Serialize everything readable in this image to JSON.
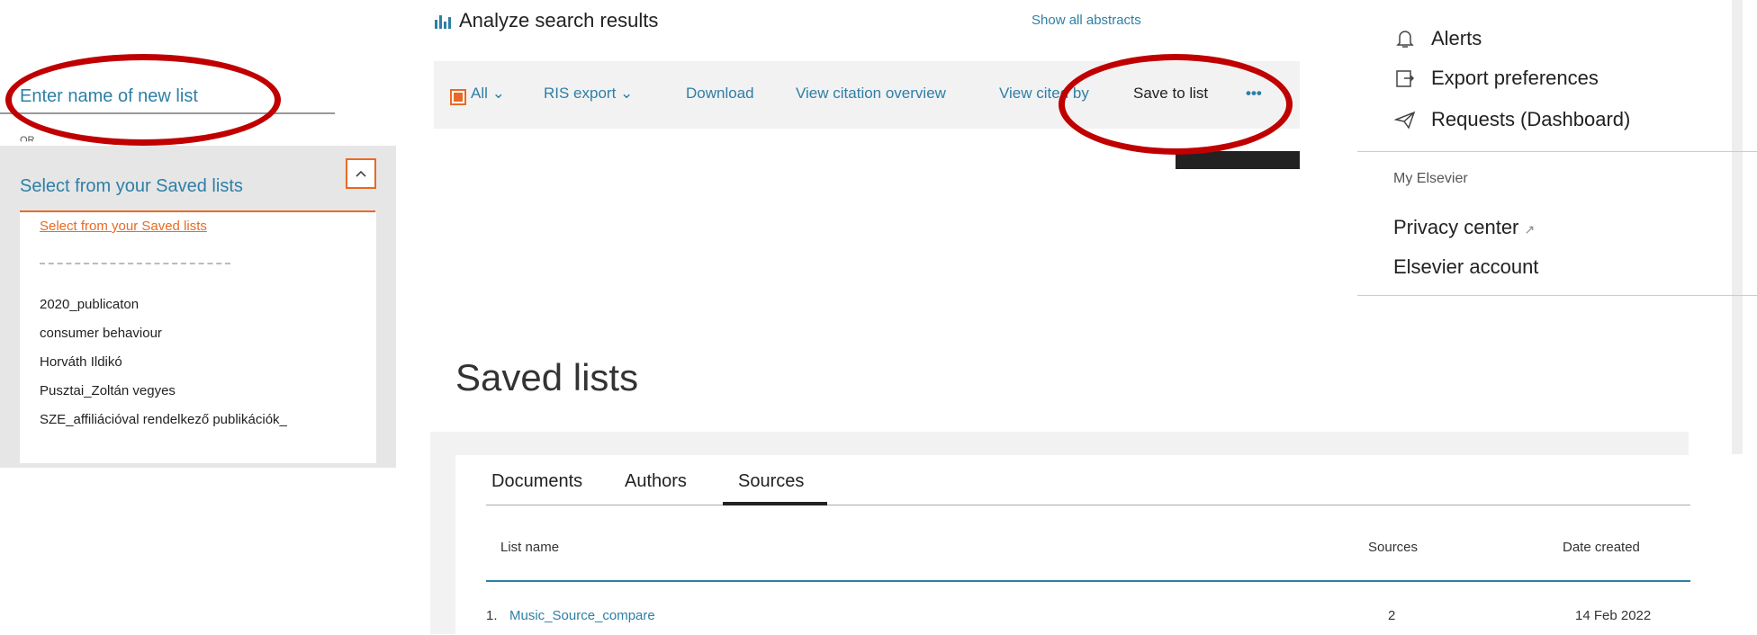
{
  "left": {
    "new_list_placeholder": "Enter name of new list",
    "or_text": "OR",
    "select_label": "Select from your Saved lists",
    "dropdown_selected": "Select from your Saved lists",
    "dropdown_items": [
      "2020_publicaton",
      "consumer behaviour",
      "Horváth Ildikó",
      "Pusztai_Zoltán vegyes",
      "SZE_affiliációval rendelkező publikációk_"
    ]
  },
  "toolbar": {
    "analyze_label": "Analyze search results",
    "show_abstracts": "Show all abstracts",
    "all_label": "All",
    "ris_export": "RIS export",
    "download": "Download",
    "view_citation_overview": "View citation overview",
    "view_cited_by": "View cited by",
    "save_to_list": "Save to list",
    "more": "•••"
  },
  "menu": {
    "alerts": "Alerts",
    "export_preferences": "Export preferences",
    "requests": "Requests (Dashboard)",
    "section_title": "My Elsevier",
    "privacy_center": "Privacy center",
    "elsevier_account": "Elsevier account"
  },
  "saved_lists": {
    "title": "Saved lists",
    "tabs": [
      "Documents",
      "Authors",
      "Sources"
    ],
    "active_tab": "Sources",
    "columns": [
      "List name",
      "Sources",
      "Date created"
    ],
    "rows": [
      {
        "num": "1.",
        "name": "Music_Source_compare",
        "sources": "2",
        "date": "14 Feb 2022"
      }
    ]
  },
  "colors": {
    "accent": "#e86a24",
    "link": "#2e7fa6",
    "annotation": "#c00000"
  }
}
